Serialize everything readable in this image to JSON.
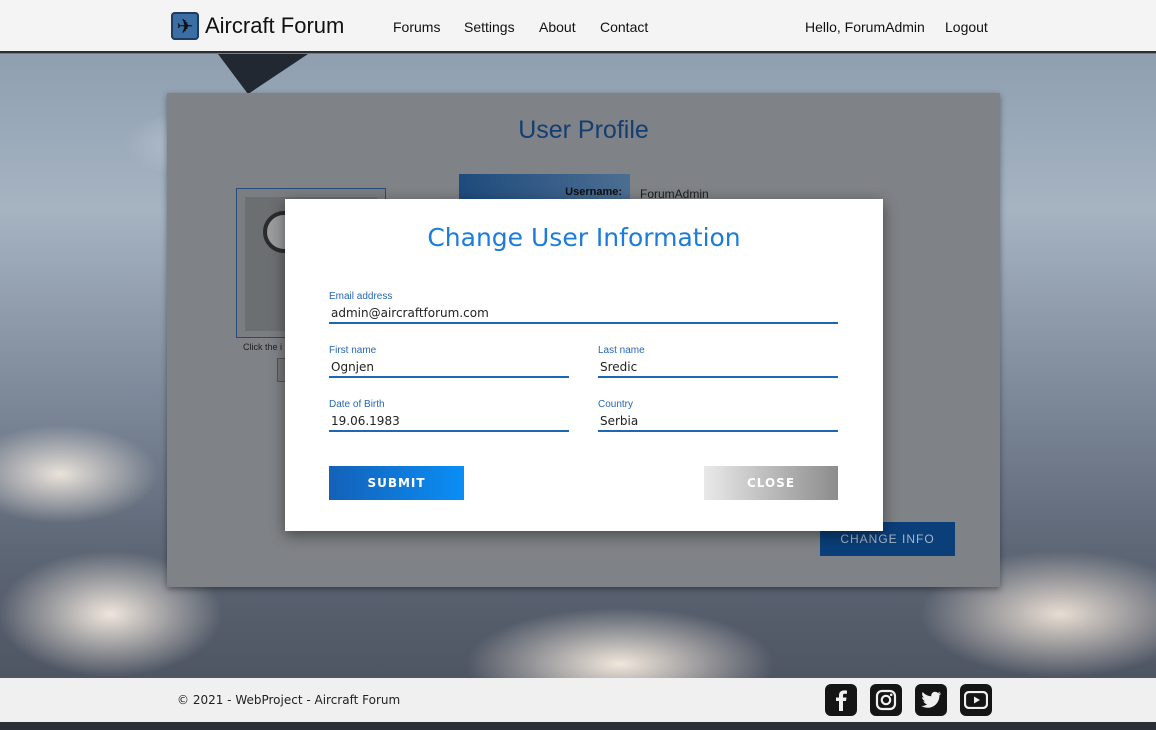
{
  "navbar": {
    "brand": "Aircraft Forum",
    "links": [
      "Forums",
      "Settings",
      "About",
      "Contact"
    ],
    "greeting": "Hello, ForumAdmin",
    "logout": "Logout"
  },
  "profile": {
    "title": "User Profile",
    "avatar_hint": "Click the i",
    "username_label": "Username:",
    "username_value": "ForumAdmin",
    "change_info_button": "CHANGE INFO"
  },
  "modal": {
    "title": "Change User Information",
    "email": {
      "label": "Email address",
      "value": "admin@aircraftforum.com"
    },
    "first_name": {
      "label": "First name",
      "value": "Ognjen"
    },
    "last_name": {
      "label": "Last name",
      "value": "Sredic"
    },
    "dob": {
      "label": "Date of Birth",
      "value": "19.06.1983"
    },
    "country": {
      "label": "Country",
      "value": "Serbia"
    },
    "submit": "SUBMIT",
    "close": "CLOSE"
  },
  "footer": {
    "copyright": "© 2021 - WebProject - Aircraft Forum",
    "social": [
      "facebook-icon",
      "instagram-icon",
      "twitter-icon",
      "youtube-icon"
    ]
  },
  "colors": {
    "accent": "#1b7dd9",
    "title_blue": "#143e72",
    "button_blue": "#0a3f79"
  }
}
